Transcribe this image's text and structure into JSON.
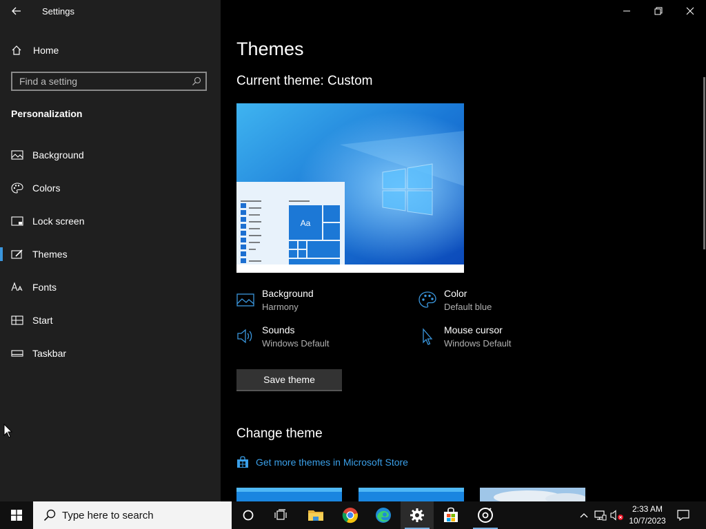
{
  "window": {
    "title": "Settings",
    "controls": [
      "minimize-icon",
      "restore-icon",
      "close-icon"
    ]
  },
  "sidebar": {
    "home_label": "Home",
    "search_placeholder": "Find a setting",
    "section_title": "Personalization",
    "items": [
      {
        "label": "Background",
        "icon": "picture-icon",
        "selected": false
      },
      {
        "label": "Colors",
        "icon": "palette-icon",
        "selected": false
      },
      {
        "label": "Lock screen",
        "icon": "lock-screen-icon",
        "selected": false
      },
      {
        "label": "Themes",
        "icon": "themes-icon",
        "selected": true
      },
      {
        "label": "Fonts",
        "icon": "fonts-icon",
        "selected": false
      },
      {
        "label": "Start",
        "icon": "start-icon",
        "selected": false
      },
      {
        "label": "Taskbar",
        "icon": "taskbar-icon",
        "selected": false
      }
    ]
  },
  "main": {
    "page_title": "Themes",
    "current_theme": "Current theme: Custom",
    "preview_tile_text": "Aa",
    "properties": [
      {
        "name": "Background",
        "value": "Harmony",
        "icon": "picture-icon"
      },
      {
        "name": "Color",
        "value": "Default blue",
        "icon": "palette-icon"
      },
      {
        "name": "Sounds",
        "value": "Windows Default",
        "icon": "speaker-icon"
      },
      {
        "name": "Mouse cursor",
        "value": "Windows Default",
        "icon": "cursor-icon"
      }
    ],
    "save_button": "Save theme",
    "change_theme_title": "Change theme",
    "store_link": "Get more themes in Microsoft Store"
  },
  "taskbar": {
    "search_placeholder": "Type here to search",
    "apps": [
      "cortana-icon",
      "task-view-icon",
      "file-explorer-icon",
      "chrome-icon",
      "edge-icon",
      "settings-icon",
      "store-icon",
      "media-player-icon"
    ],
    "clock_time": "2:33 AM",
    "clock_date": "10/7/2023"
  },
  "colors": {
    "accent": "#3a96dd",
    "link": "#3a9fe8",
    "sidebar_bg": "#1f1f1f",
    "main_bg": "#000000",
    "taskbar_bg": "#101010"
  }
}
